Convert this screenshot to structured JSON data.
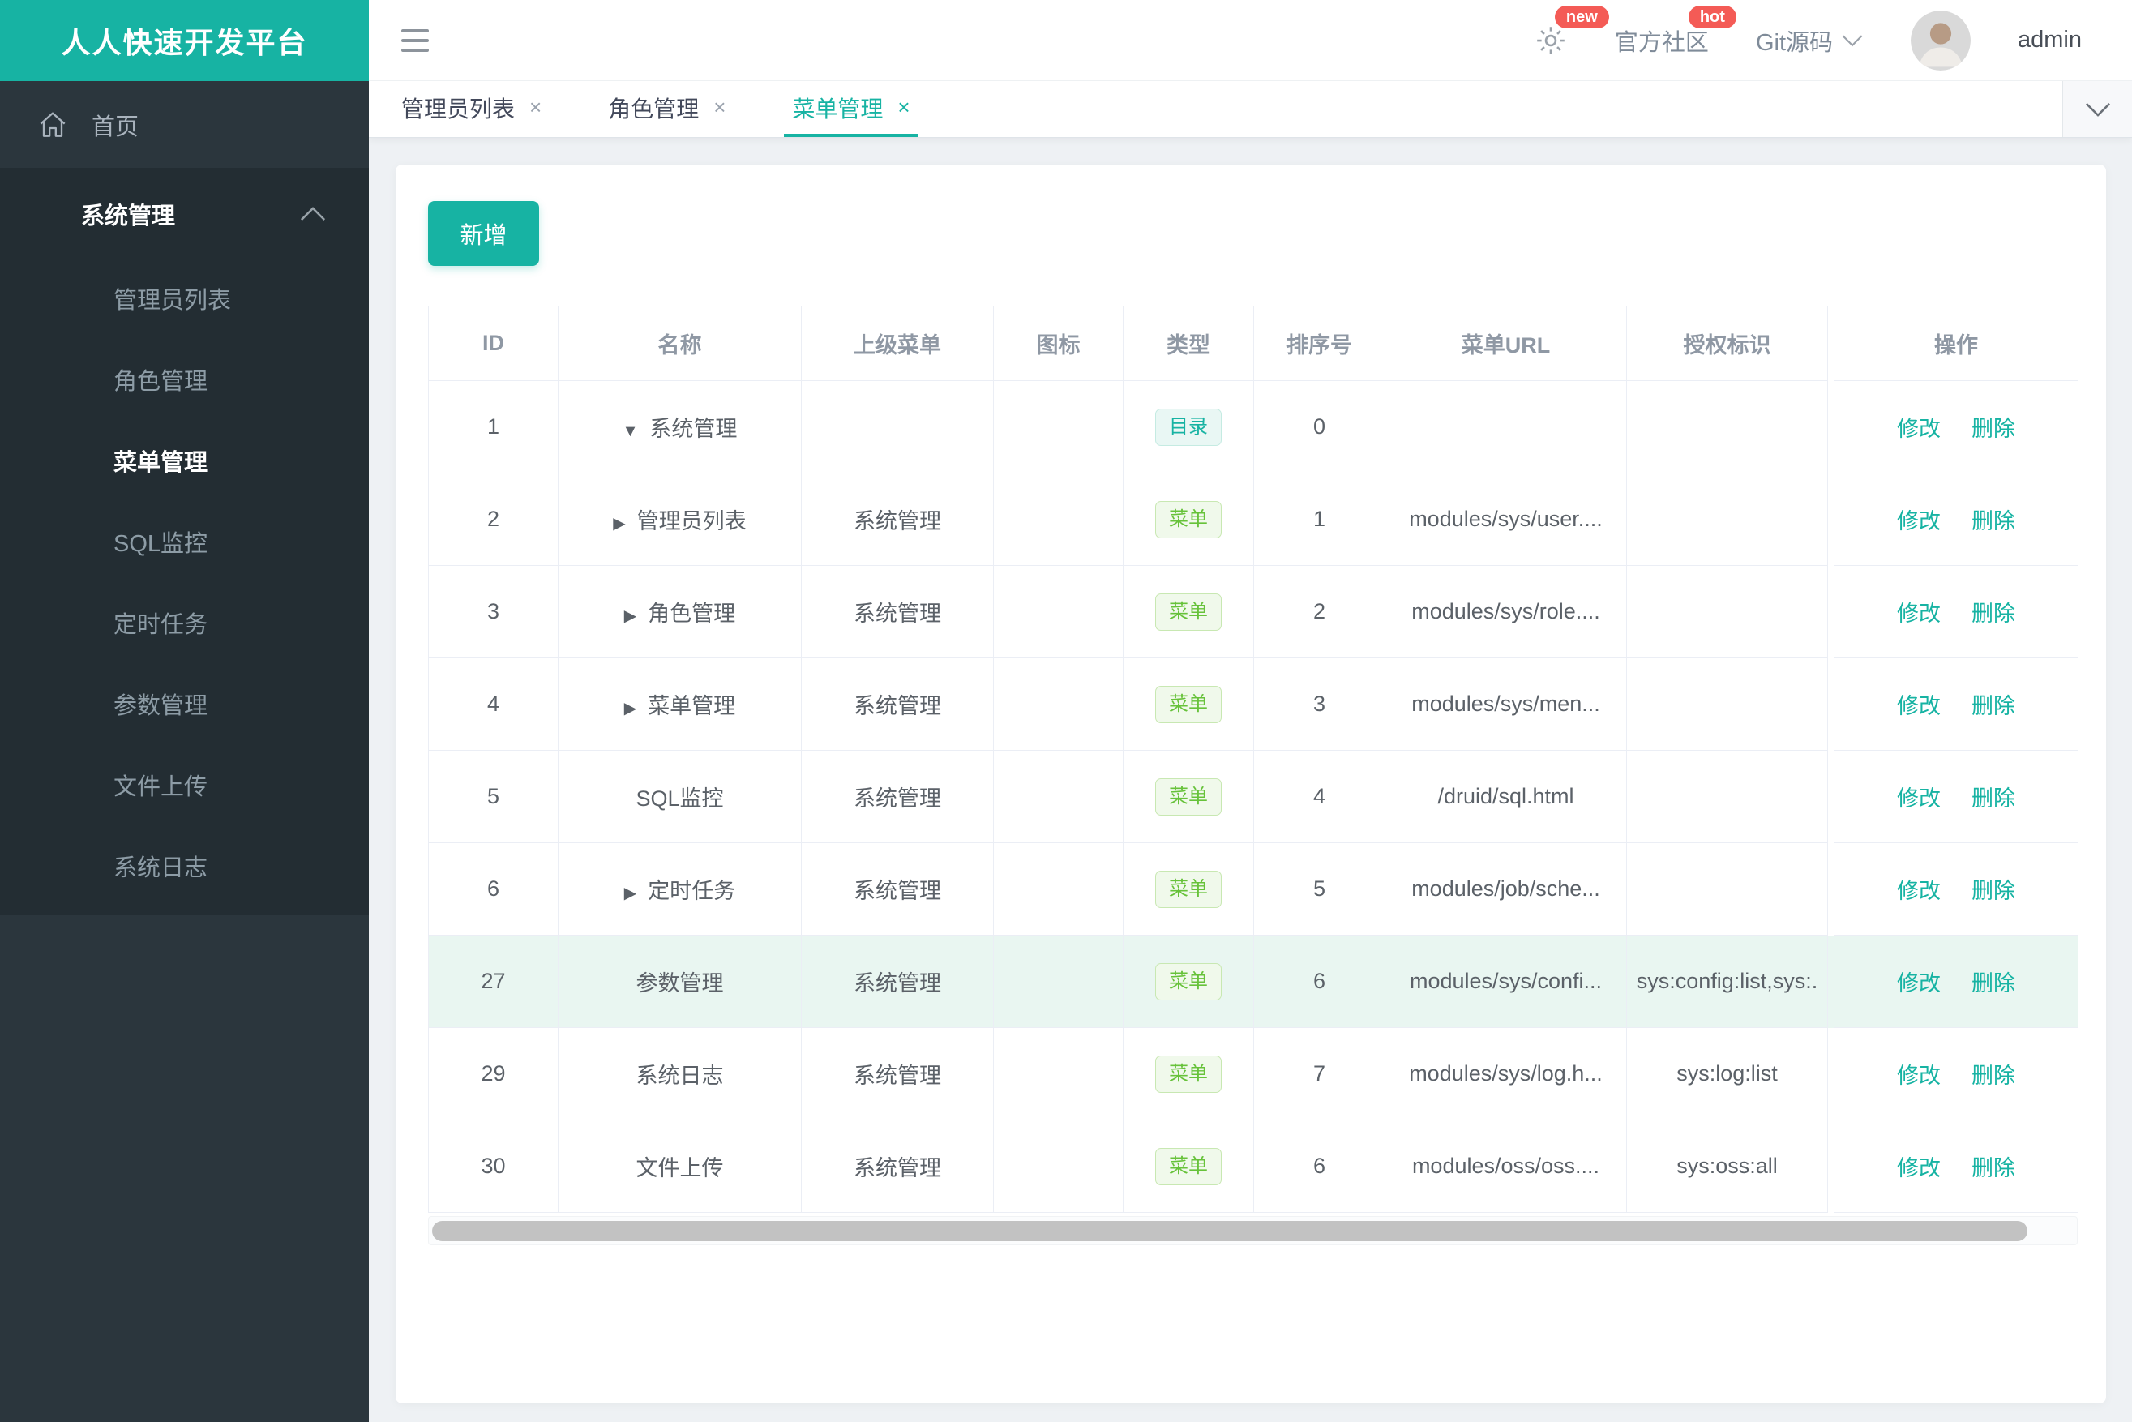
{
  "brand": {
    "title": "人人快速开发平台"
  },
  "header": {
    "settings_badge": "new",
    "community_label": "官方社区",
    "community_badge": "hot",
    "git_label": "Git源码",
    "username": "admin"
  },
  "tabs": [
    {
      "label": "管理员列表",
      "close": "×",
      "active": false
    },
    {
      "label": "角色管理",
      "close": "×",
      "active": false
    },
    {
      "label": "菜单管理",
      "close": "×",
      "active": true
    }
  ],
  "sidebar": {
    "home_label": "首页",
    "group_label": "系统管理",
    "items": [
      {
        "label": "管理员列表",
        "active": false
      },
      {
        "label": "角色管理",
        "active": false
      },
      {
        "label": "菜单管理",
        "active": true
      },
      {
        "label": "SQL监控",
        "active": false
      },
      {
        "label": "定时任务",
        "active": false
      },
      {
        "label": "参数管理",
        "active": false
      },
      {
        "label": "文件上传",
        "active": false
      },
      {
        "label": "系统日志",
        "active": false
      }
    ]
  },
  "toolbar": {
    "add_label": "新增"
  },
  "icons": {
    "hamburger": "hamburger-icon",
    "gear": "gear-icon",
    "home": "home-icon",
    "chevron_up": "chevron-up-icon",
    "chevron_down": "chevron-down-icon",
    "avatar": "user-avatar",
    "down": "▼",
    "right": "▶",
    "none": ""
  },
  "table": {
    "columns": [
      "ID",
      "名称",
      "上级菜单",
      "图标",
      "类型",
      "排序号",
      "菜单URL",
      "授权标识",
      "操作"
    ],
    "actions": {
      "edit": "修改",
      "delete": "删除"
    },
    "rows": [
      {
        "id": "1",
        "arrow": "down",
        "name": "系统管理",
        "parent": "",
        "icon": "",
        "type": "目录",
        "type_kind": "dir",
        "order": "0",
        "url": "",
        "perms": "",
        "highlight": false
      },
      {
        "id": "2",
        "arrow": "right",
        "name": "管理员列表",
        "parent": "系统管理",
        "icon": "",
        "type": "菜单",
        "type_kind": "menu",
        "order": "1",
        "url": "modules/sys/user....",
        "perms": "",
        "highlight": false
      },
      {
        "id": "3",
        "arrow": "right",
        "name": "角色管理",
        "parent": "系统管理",
        "icon": "",
        "type": "菜单",
        "type_kind": "menu",
        "order": "2",
        "url": "modules/sys/role....",
        "perms": "",
        "highlight": false
      },
      {
        "id": "4",
        "arrow": "right",
        "name": "菜单管理",
        "parent": "系统管理",
        "icon": "",
        "type": "菜单",
        "type_kind": "menu",
        "order": "3",
        "url": "modules/sys/men...",
        "perms": "",
        "highlight": false
      },
      {
        "id": "5",
        "arrow": "none",
        "name": "SQL监控",
        "parent": "系统管理",
        "icon": "",
        "type": "菜单",
        "type_kind": "menu",
        "order": "4",
        "url": "/druid/sql.html",
        "perms": "",
        "highlight": false
      },
      {
        "id": "6",
        "arrow": "right",
        "name": "定时任务",
        "parent": "系统管理",
        "icon": "",
        "type": "菜单",
        "type_kind": "menu",
        "order": "5",
        "url": "modules/job/sche...",
        "perms": "",
        "highlight": false
      },
      {
        "id": "27",
        "arrow": "none",
        "name": "参数管理",
        "parent": "系统管理",
        "icon": "",
        "type": "菜单",
        "type_kind": "menu",
        "order": "6",
        "url": "modules/sys/confi...",
        "perms": "sys:config:list,sys:.",
        "highlight": true
      },
      {
        "id": "29",
        "arrow": "none",
        "name": "系统日志",
        "parent": "系统管理",
        "icon": "",
        "type": "菜单",
        "type_kind": "menu",
        "order": "7",
        "url": "modules/sys/log.h...",
        "perms": "sys:log:list",
        "highlight": false
      },
      {
        "id": "30",
        "arrow": "none",
        "name": "文件上传",
        "parent": "系统管理",
        "icon": "",
        "type": "菜单",
        "type_kind": "menu",
        "order": "6",
        "url": "modules/oss/oss....",
        "perms": "sys:oss:all",
        "highlight": false
      }
    ]
  },
  "colors": {
    "accent": "#17b3a3",
    "sidebar_bg": "#2b363d",
    "sidebar_submenu_bg": "#232d33",
    "content_bg": "#eef1f4",
    "border": "#ebeef5",
    "badge_red": "#f45b56",
    "row_highlight": "#e9f6f1",
    "menu_green": "#67c23a",
    "badge_dir_bg": "#e9f7f4",
    "badge_dir_border": "#c5ebe2",
    "badge_menu_bg": "#f0f9eb",
    "badge_menu_border": "#c8e8b2"
  }
}
